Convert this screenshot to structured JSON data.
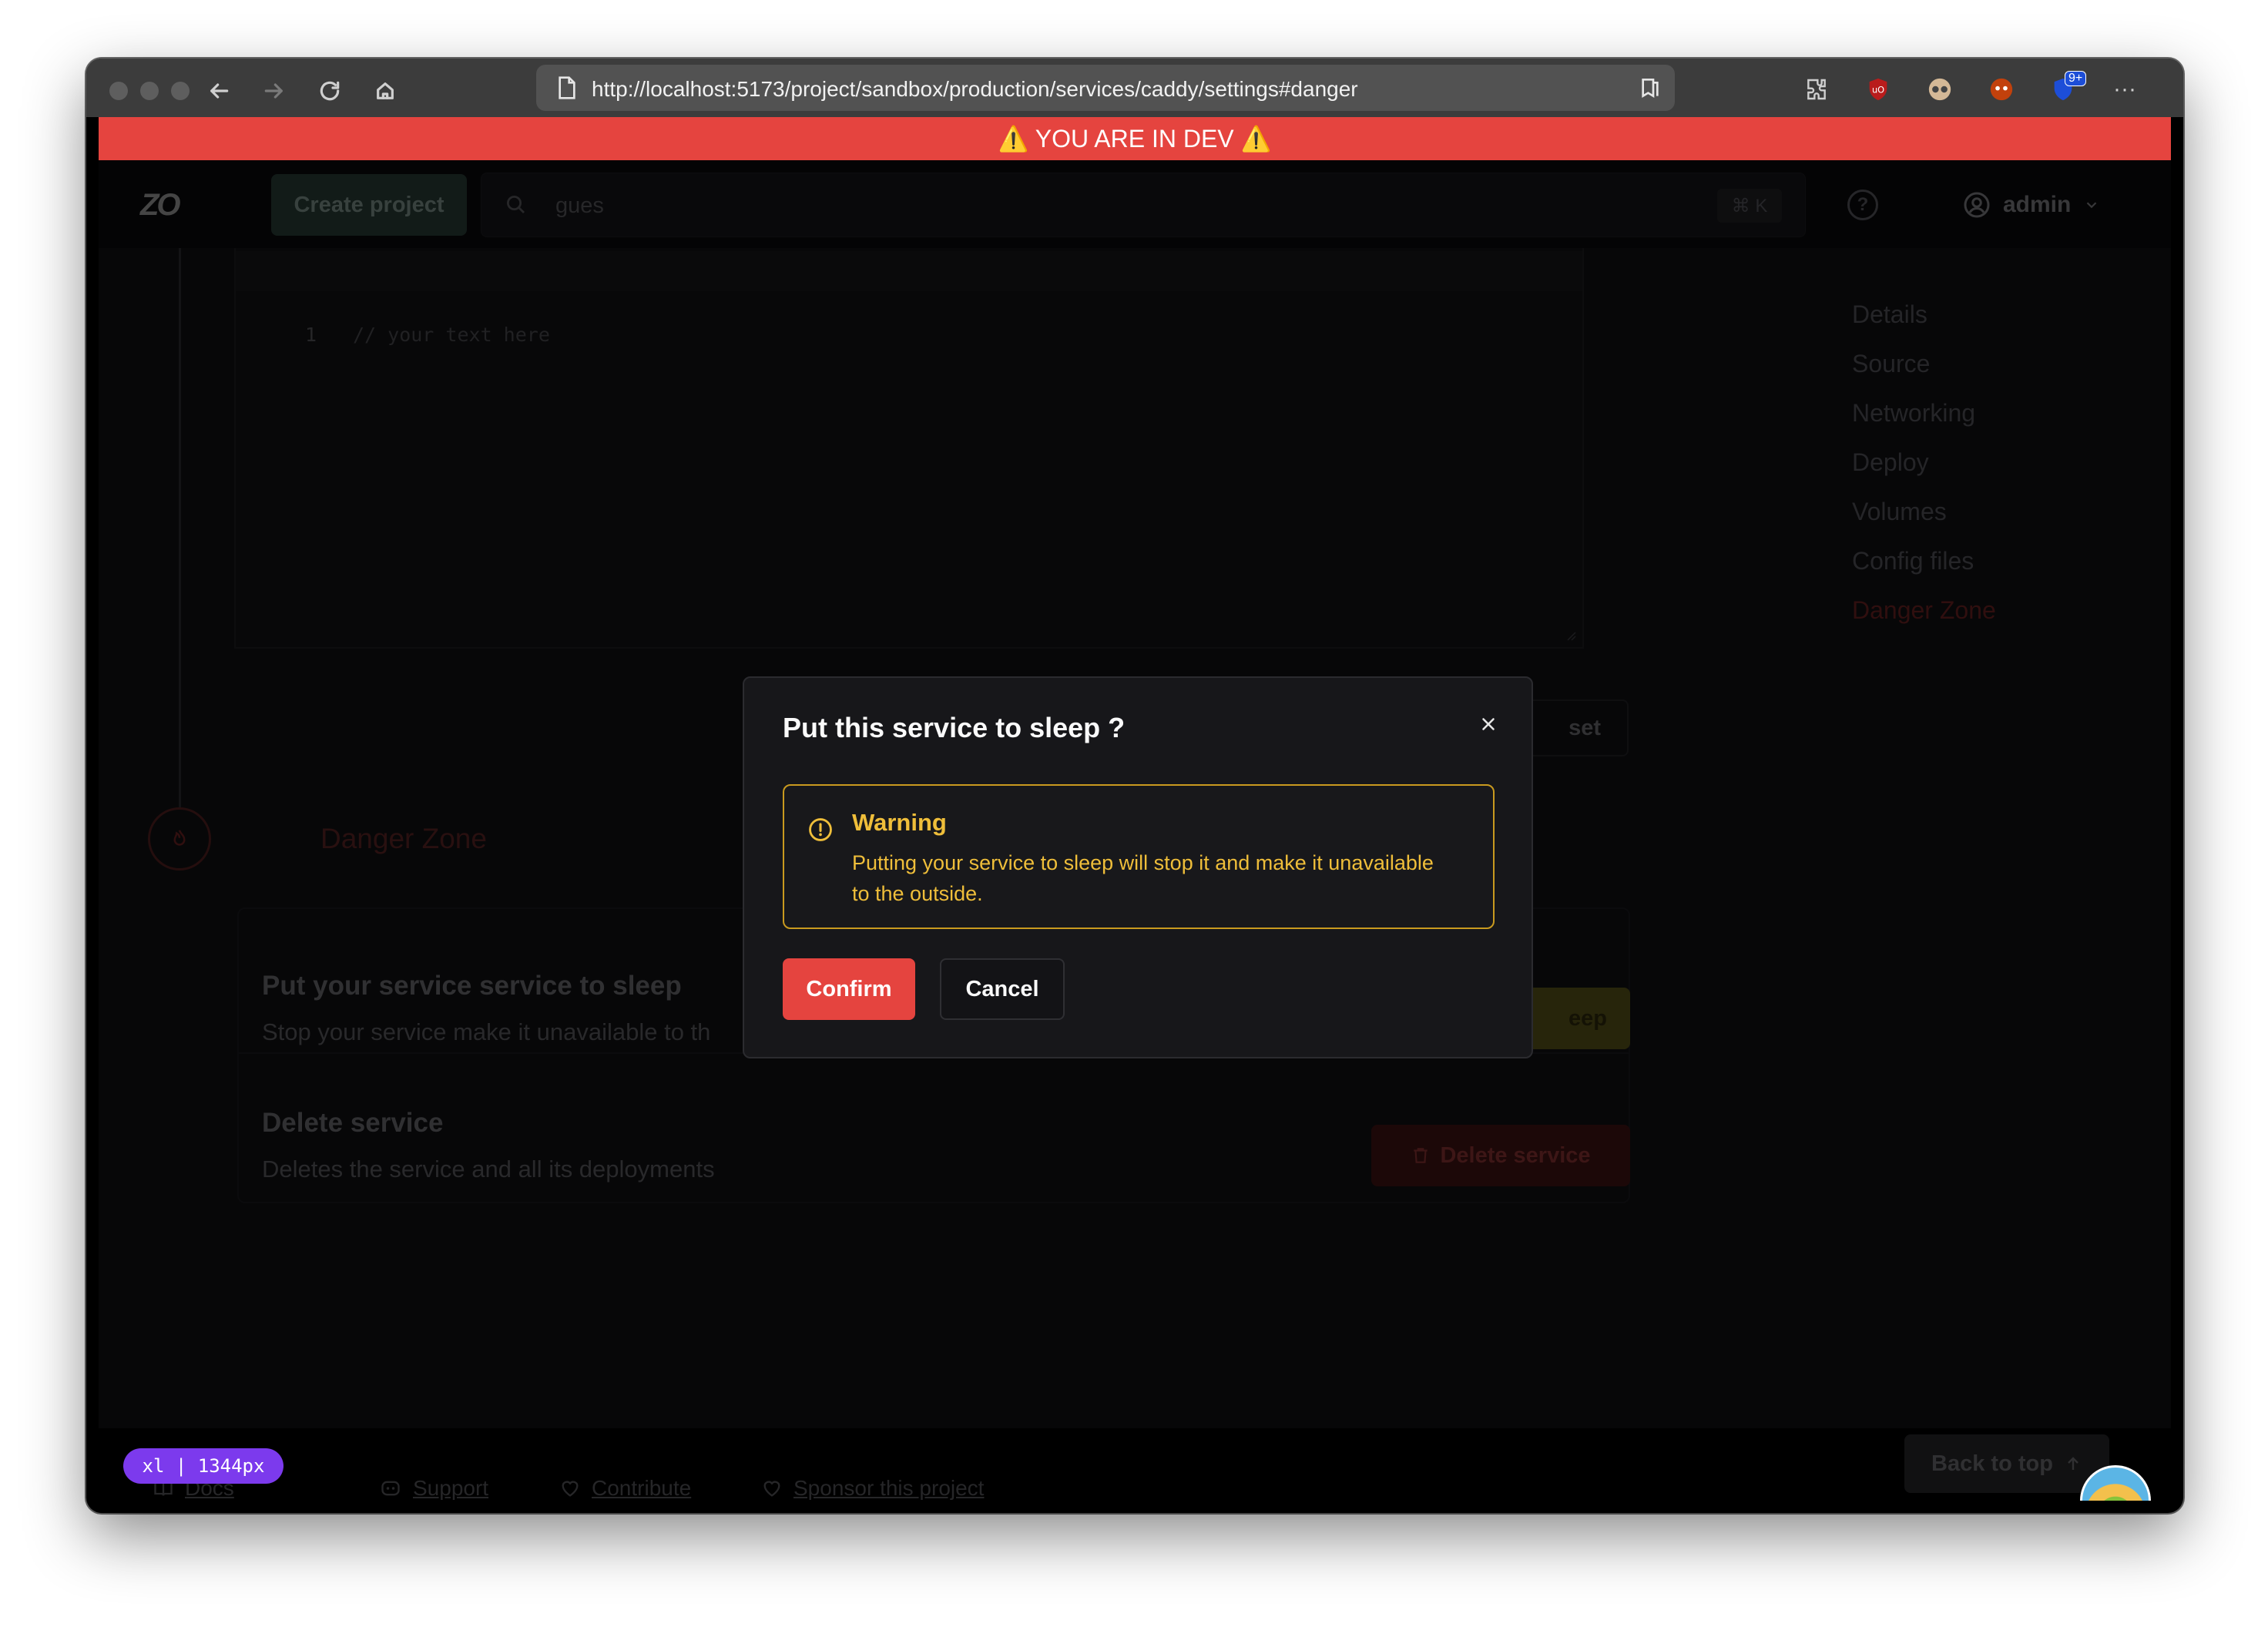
{
  "browser": {
    "url": "http://localhost:5173/project/sandbox/production/services/caddy/settings#danger",
    "extension_badge": "9+"
  },
  "dev_banner": {
    "text": "⚠️ YOU ARE IN DEV ⚠️"
  },
  "header": {
    "logo": "ZO",
    "create_project_label": "Create project",
    "search_value": "gues",
    "search_shortcut": "⌘ K",
    "user_name": "admin"
  },
  "editor": {
    "line_number": "1",
    "placeholder": "// your text here"
  },
  "config_actions": {
    "reset_label": "set"
  },
  "settings_nav": {
    "items": [
      "Details",
      "Source",
      "Networking",
      "Deploy",
      "Volumes",
      "Config files",
      "Danger Zone"
    ],
    "active": "Danger Zone"
  },
  "danger_zone": {
    "title": "Danger Zone",
    "sleep_card": {
      "title": "Put your service service to sleep",
      "description": "Stop your service make it unavailable to th",
      "button_label": "eep"
    },
    "delete_card": {
      "title": "Delete service",
      "description": "Deletes the service and all its deployments",
      "button_label": "Delete service"
    }
  },
  "modal": {
    "title": "Put this service to sleep ?",
    "alert_title": "Warning",
    "alert_text": "Putting your service to sleep will stop it and make it unavailable to the outside.",
    "confirm_label": "Confirm",
    "cancel_label": "Cancel"
  },
  "footer": {
    "breakpoint_badge": "xl | 1344px",
    "links": [
      "Docs",
      "Support",
      "Contribute",
      "Sponsor this project"
    ],
    "back_to_top_label": "Back to top"
  },
  "colors": {
    "dev_banner": "#e5443f",
    "confirm": "#e5443f",
    "warning": "#efbe3a",
    "breakpoint_badge": "#7c3aed"
  }
}
